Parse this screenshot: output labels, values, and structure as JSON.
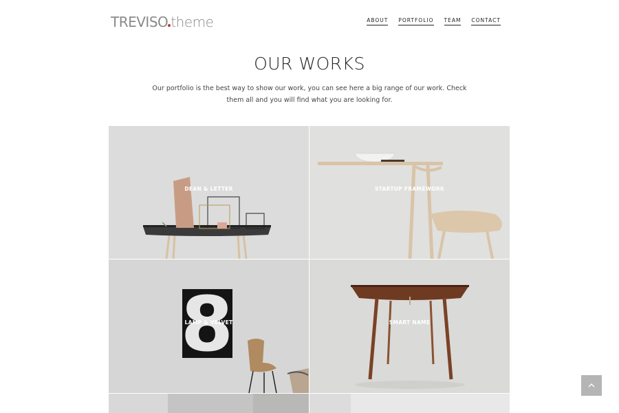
{
  "header": {
    "logo_brand": "TREVISO",
    "logo_suffix": "theme",
    "nav": [
      {
        "label": "ABOUT"
      },
      {
        "label": "PORTFOLIO"
      },
      {
        "label": "TEAM"
      },
      {
        "label": "CONTACT"
      }
    ]
  },
  "works": {
    "title": "OUR WORKS",
    "description": "Our portfolio is the best way to show our work, you can see here a big range of our work. Check them all and you will find what you are looking for.",
    "items": [
      {
        "label": "DEAN & LETTER"
      },
      {
        "label": "STARTUP FRAMEWORK"
      },
      {
        "label": "LAMP & VELVET"
      },
      {
        "label": "SMART NAME"
      }
    ]
  },
  "scroll_top": {
    "icon": "chevron-up-icon"
  },
  "colors": {
    "logo_dot": "#c0392b",
    "text": "#222222",
    "button": "#b5b5b5"
  }
}
